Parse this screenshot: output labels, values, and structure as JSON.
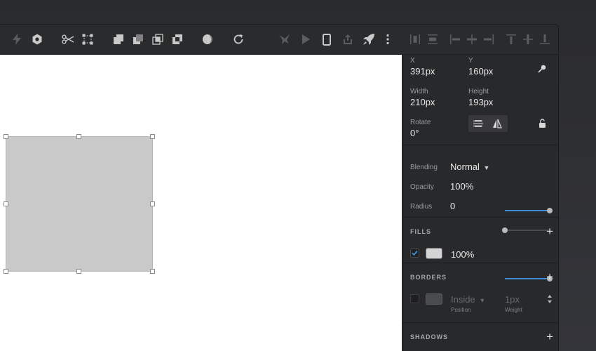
{
  "toolbar": {
    "items": [
      {
        "icon": "bolt-icon",
        "enabled": false
      },
      {
        "icon": "hexagon-nut-icon",
        "enabled": true
      },
      {
        "icon": "scissors-icon",
        "enabled": true
      },
      {
        "icon": "bounding-box-icon",
        "enabled": true
      },
      {
        "icon": "union-icon",
        "enabled": true
      },
      {
        "icon": "subtract-icon",
        "enabled": true
      },
      {
        "icon": "intersect-icon",
        "enabled": true
      },
      {
        "icon": "difference-icon",
        "enabled": true
      },
      {
        "icon": "mask-icon",
        "enabled": true
      },
      {
        "icon": "refresh-icon",
        "enabled": true
      },
      {
        "icon": "bird-icon",
        "enabled": false
      },
      {
        "icon": "play-icon",
        "enabled": false
      },
      {
        "icon": "mobile-device-icon",
        "enabled": true
      },
      {
        "icon": "upload-icon",
        "enabled": false
      },
      {
        "icon": "rocket-icon",
        "enabled": true
      },
      {
        "icon": "more-vertical-icon",
        "enabled": true
      },
      {
        "icon": "distribute-horizontal-icon",
        "enabled": false
      },
      {
        "icon": "distribute-vertical-icon",
        "enabled": false
      },
      {
        "icon": "align-left-icon",
        "enabled": false
      },
      {
        "icon": "align-center-icon",
        "enabled": false
      },
      {
        "icon": "align-right-icon",
        "enabled": false
      },
      {
        "icon": "align-top-icon",
        "enabled": false
      },
      {
        "icon": "align-middle-icon",
        "enabled": false
      },
      {
        "icon": "align-bottom-icon",
        "enabled": false
      }
    ]
  },
  "inspector": {
    "x_label": "X",
    "x_value": "391px",
    "y_label": "Y",
    "y_value": "160px",
    "width_label": "Width",
    "width_value": "210px",
    "height_label": "Height",
    "height_value": "193px",
    "rotate_label": "Rotate",
    "rotate_value": "0°",
    "blending_label": "Blending",
    "blending_value": "Normal",
    "opacity_label": "Opacity",
    "opacity_value": "100%",
    "opacity_fraction": 1.0,
    "radius_label": "Radius",
    "radius_value": "0",
    "radius_fraction": 0.0,
    "fills": {
      "title": "FILLS",
      "opacity": "100%",
      "opacity_fraction": 1.0,
      "enabled": true,
      "color": "#d4d4d4"
    },
    "borders": {
      "title": "BORDERS",
      "position_value": "Inside",
      "position_label": "Position",
      "weight_value": "1px",
      "weight_label": "Weight",
      "enabled": false,
      "color": "#555658"
    },
    "shadows": {
      "title": "SHADOWS"
    }
  },
  "colors": {
    "accent": "#3d8fdc",
    "shape_fill": "#c9c9c9",
    "panel": "#28292b"
  }
}
